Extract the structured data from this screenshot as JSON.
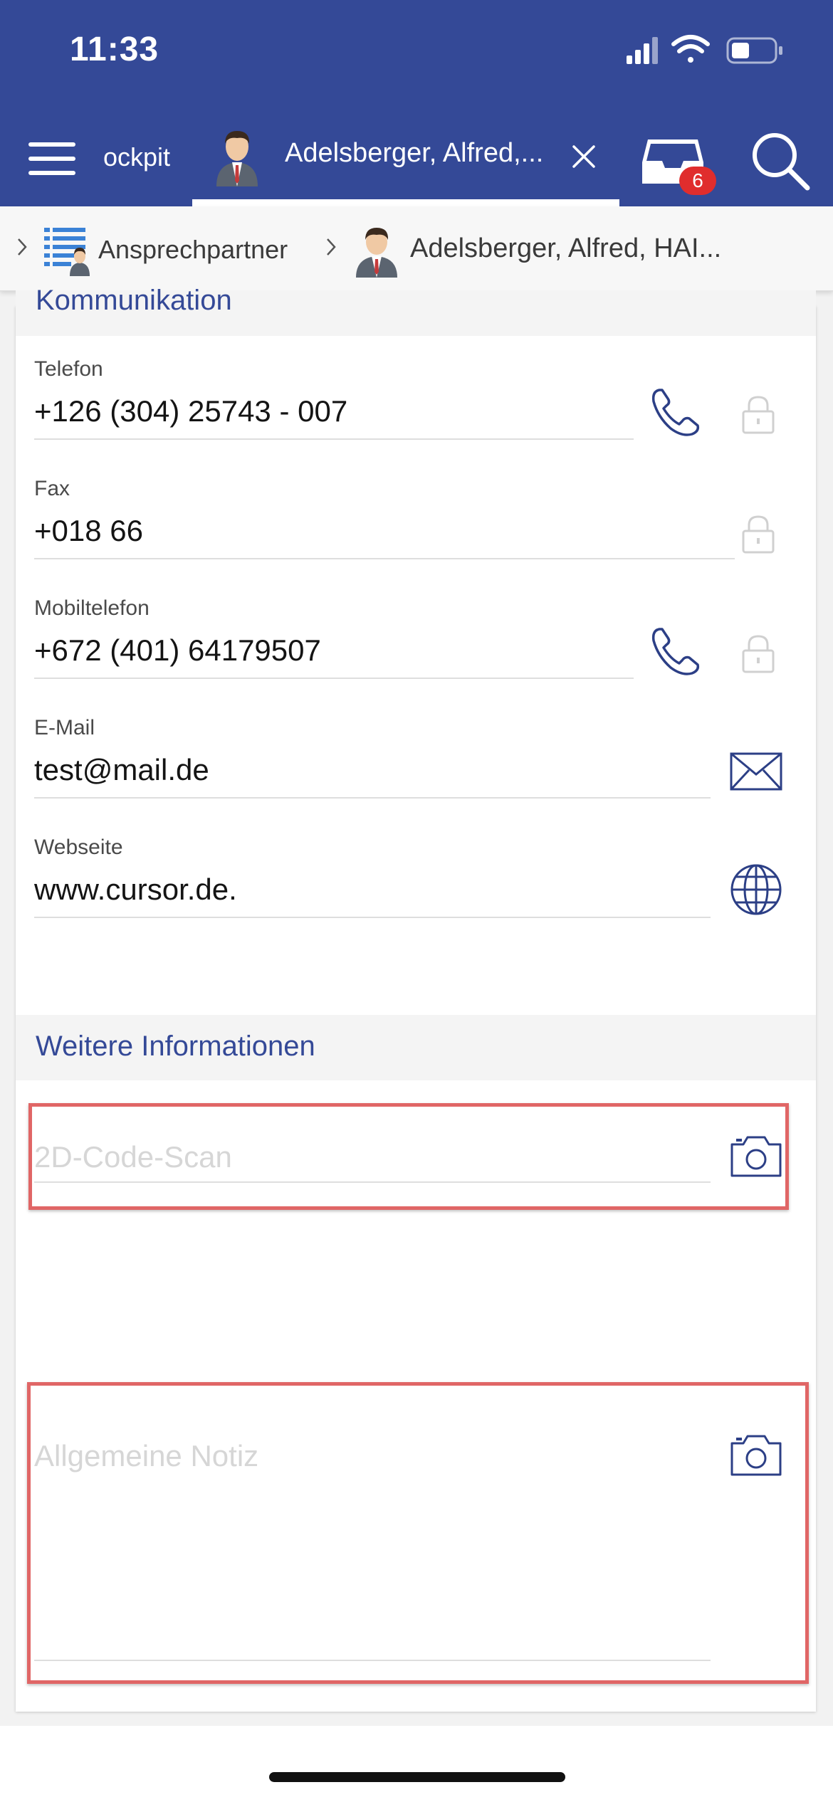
{
  "status_bar": {
    "time": "11:33"
  },
  "toolbar": {
    "prev_tab_label": "ockpit",
    "active_tab_label": "Adelsberger, Alfred,...",
    "inbox_badge": "6"
  },
  "breadcrumb": {
    "items": [
      {
        "label": "Ansprechpartner",
        "icon": "list-person-icon"
      },
      {
        "label": "Adelsberger, Alfred, HAI...",
        "icon": "person-avatar-icon"
      }
    ]
  },
  "sections": {
    "kommunikation": {
      "title": "Kommunikation",
      "fields": [
        {
          "label": "Telefon",
          "value": "+126 (304) 25743 - 007",
          "action_icon": "phone-icon",
          "lock": true
        },
        {
          "label": "Fax",
          "value": "+018 66",
          "action_icon": null,
          "lock": true
        },
        {
          "label": "Mobiltelefon",
          "value": "+672 (401) 64179507",
          "action_icon": "phone-icon",
          "lock": true
        },
        {
          "label": "E-Mail",
          "value": "test@mail.de",
          "action_icon": "mail-icon",
          "lock": false
        },
        {
          "label": "Webseite",
          "value": "www.cursor.de.",
          "action_icon": "globe-icon",
          "lock": false
        }
      ]
    },
    "weitere": {
      "title": "Weitere Informationen",
      "scan_placeholder": "2D-Code-Scan",
      "note_placeholder": "Allgemeine Notiz"
    }
  },
  "colors": {
    "brand": "#344997",
    "highlight": "#e06666",
    "badge": "#e02d2d"
  }
}
